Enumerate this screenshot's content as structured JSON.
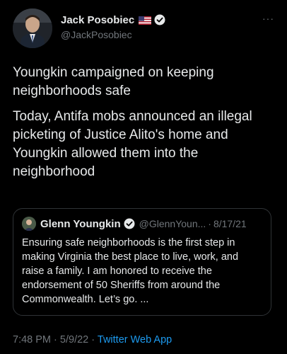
{
  "tweet": {
    "author": {
      "display_name": "Jack Posobiec",
      "handle": "@JackPosobiec",
      "flag": "us-flag-icon",
      "verified": true
    },
    "more_icon": "···",
    "paragraphs": [
      "Youngkin campaigned on keeping neighborhoods safe",
      "Today, Antifa mobs announced an illegal picketing of Justice Alito's home and Youngkin allowed them into the neighborhood"
    ],
    "quoted": {
      "display_name": "Glenn Youngkin",
      "handle": "@GlennYoun...",
      "separator": "·",
      "date": "8/17/21",
      "text": "Ensuring safe neighborhoods is the first step in making Virginia the best place to live, work, and raise a family. I am honored to receive the endorsement of 50 Sheriffs from around the Commonwealth. Let’s go. ..."
    },
    "meta": {
      "time": "7:48 PM",
      "separator": "·",
      "date": "5/9/22",
      "source": "Twitter Web App"
    }
  },
  "colors": {
    "background": "#000000",
    "text": "#e7e9ea",
    "secondary": "#71767b",
    "accent": "#1d9bf0",
    "border": "#2f3336"
  }
}
